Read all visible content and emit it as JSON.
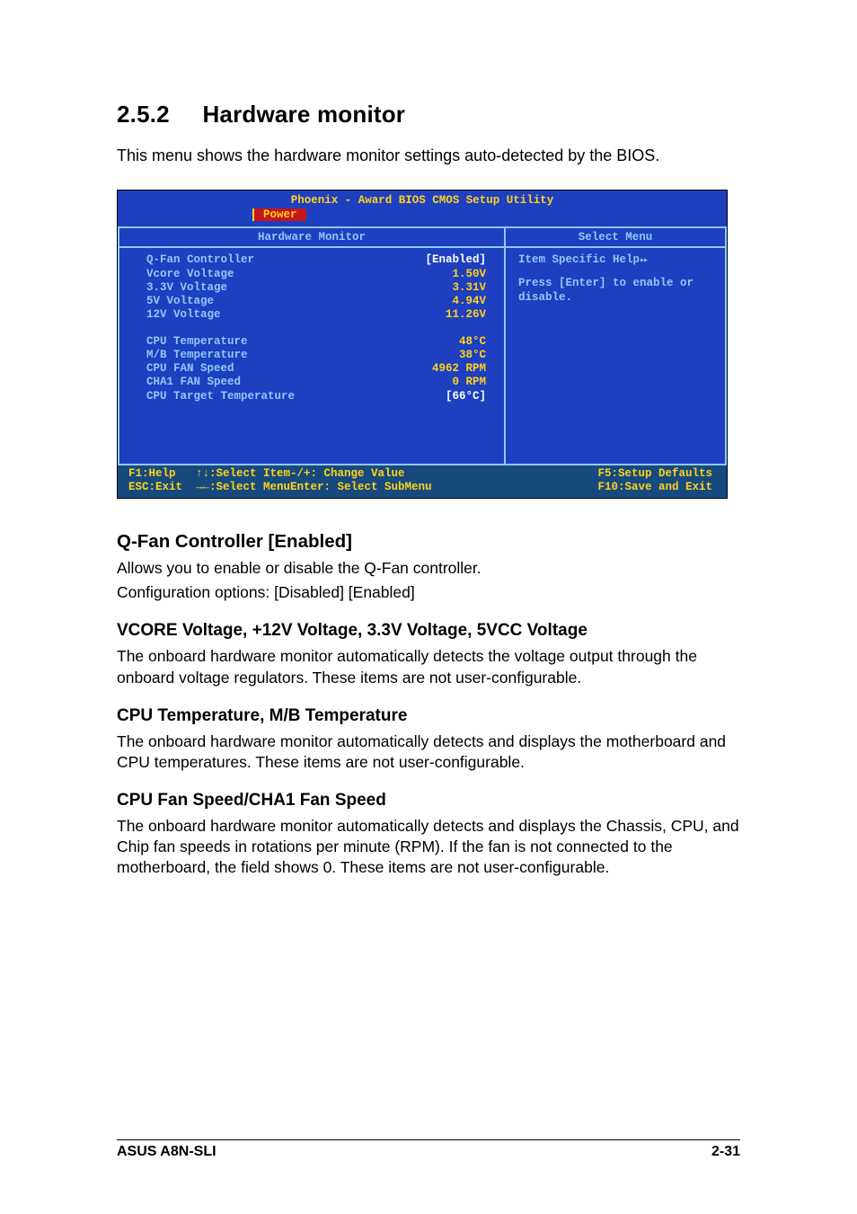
{
  "section": {
    "number": "2.5.2",
    "title": "Hardware monitor"
  },
  "intro": "This menu shows the hardware monitor settings auto-detected by the BIOS.",
  "bios": {
    "title": "Phoenix - Award BIOS CMOS Setup Utility",
    "tab": "Power",
    "headers": {
      "left": "Hardware Monitor",
      "right": "Select Menu"
    },
    "items": [
      {
        "label": "Q-Fan Controller",
        "value": "[Enabled]",
        "bracket": true
      },
      {
        "label": "Vcore Voltage",
        "value": "1.50V"
      },
      {
        "label": "3.3V Voltage",
        "value": "3.31V"
      },
      {
        "label": "5V Voltage",
        "value": "4.94V"
      },
      {
        "label": "12V Voltage",
        "value": "11.26V"
      }
    ],
    "items2": [
      {
        "label": "CPU Temperature",
        "value": "48°C"
      },
      {
        "label": "M/B Temperature",
        "value": "38°C"
      },
      {
        "label": "CPU FAN Speed",
        "value": "4962 RPM"
      },
      {
        "label": "CHA1 FAN Speed",
        "value": "0 RPM"
      },
      {
        "label": "CPU Target Temperature",
        "value": "[66°C]",
        "bracket": true
      }
    ],
    "help": {
      "title": "Item Specific Help",
      "body": "Press [Enter] to enable or disable."
    },
    "footer": {
      "row1": {
        "c1": "F1:Help   ↑↓:Select Item",
        "c2": "-/+: Change Value",
        "c3": "F5:Setup Defaults"
      },
      "row2": {
        "c1": "ESC:Exit  →←:Select Menu",
        "c2": "Enter: Select SubMenu",
        "c3": "F10:Save and Exit"
      }
    }
  },
  "sections": {
    "qfan": {
      "heading": "Q-Fan Controller [Enabled]",
      "p1": "Allows you to enable or disable the Q-Fan controller.",
      "p2": "Configuration options: [Disabled] [Enabled]"
    },
    "vcore": {
      "heading": "VCORE Voltage, +12V Voltage, 3.3V Voltage, 5VCC Voltage",
      "p": "The onboard hardware monitor automatically detects the voltage output through the onboard voltage regulators. These items are not user-configurable."
    },
    "temps": {
      "heading": "CPU Temperature, M/B Temperature",
      "p": "The onboard hardware monitor automatically detects and displays the motherboard and CPU temperatures. These items are not user-configurable."
    },
    "fans": {
      "heading": "CPU Fan Speed/CHA1 Fan Speed",
      "p": "The onboard hardware monitor automatically detects and displays the Chassis, CPU, and Chip fan speeds in rotations per minute (RPM). If the fan is not connected to the motherboard, the field shows 0. These items are not user-configurable."
    }
  },
  "footer": {
    "left": "ASUS A8N-SLI",
    "right": "2-31"
  }
}
